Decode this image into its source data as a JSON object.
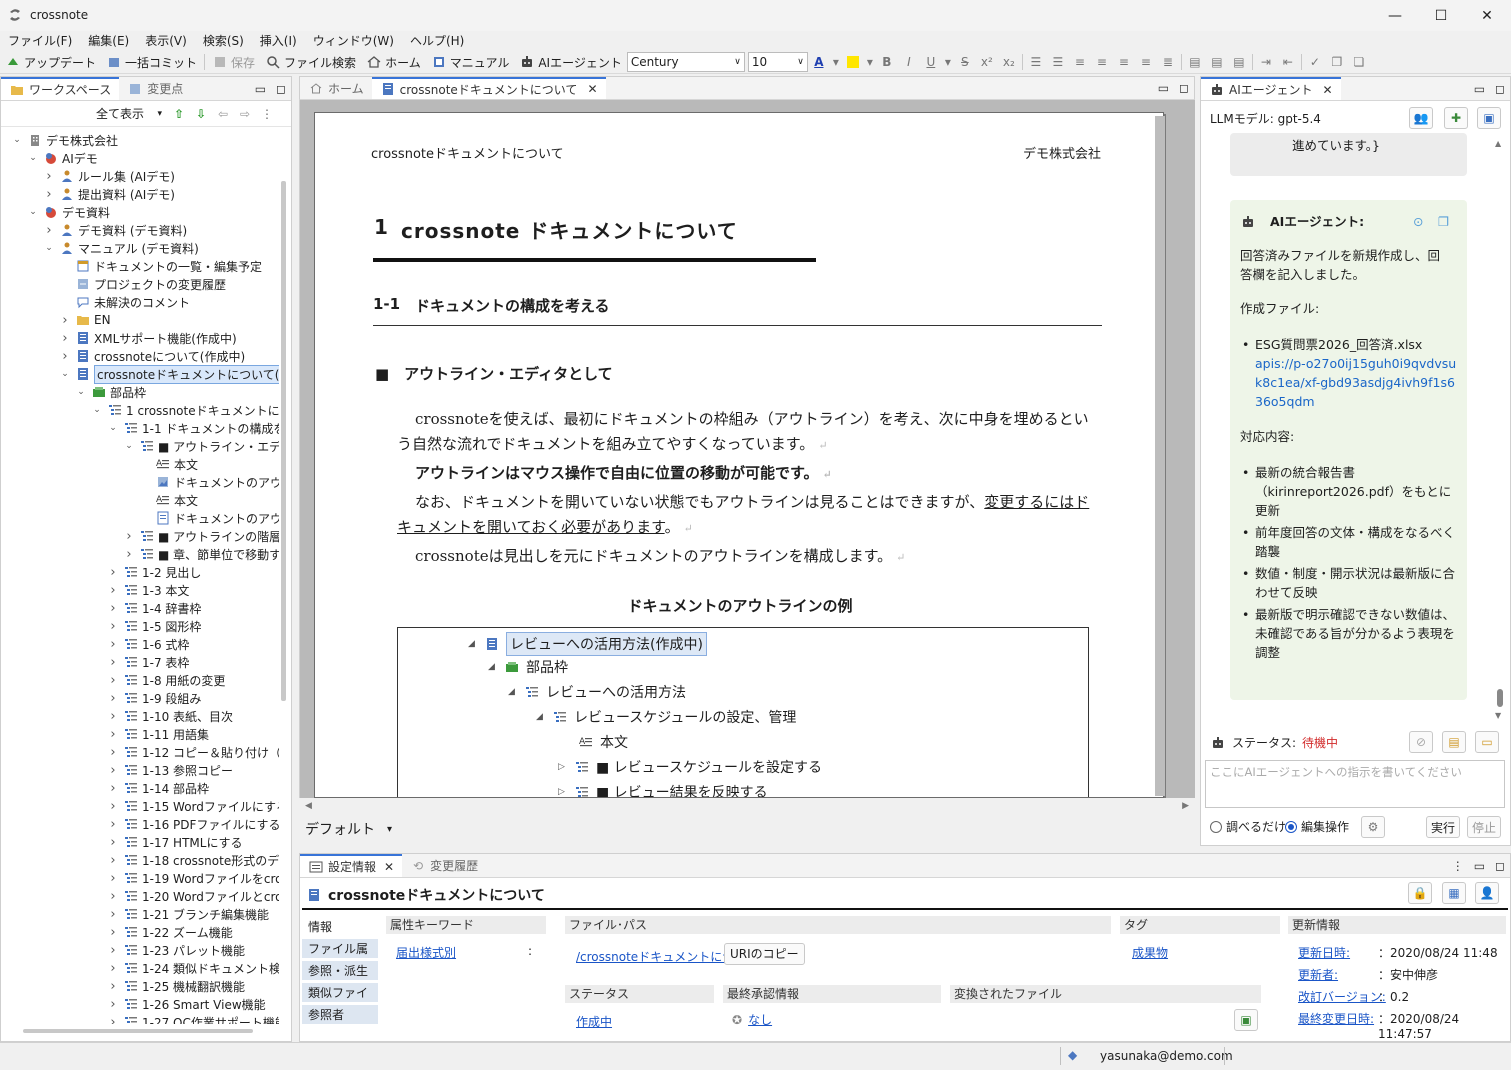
{
  "window": {
    "title": "crossnote"
  },
  "menu": [
    "ファイル(F)",
    "編集(E)",
    "表示(V)",
    "検索(S)",
    "挿入(I)",
    "ウィンドウ(W)",
    "ヘルプ(H)"
  ],
  "toolbar": {
    "update": "アップデート",
    "commit": "一括コミット",
    "save": "保存",
    "file_search": "ファイル検索",
    "home": "ホーム",
    "manual": "マニュアル",
    "ai_agent": "AIエージェント",
    "font": "Century",
    "size": "10"
  },
  "left_panel": {
    "tab_workspace": "ワークスペース",
    "tab_changes": "変更点",
    "filter": "全て表示",
    "tree": [
      {
        "d": 0,
        "t": "デモ株式会社",
        "a": "v",
        "i": "bldg"
      },
      {
        "d": 1,
        "t": "AIデモ",
        "a": "v",
        "i": "ws"
      },
      {
        "d": 2,
        "t": "ルール集 (AIデモ)",
        "a": ">",
        "i": "user"
      },
      {
        "d": 2,
        "t": "提出資料 (AIデモ)",
        "a": ">",
        "i": "user"
      },
      {
        "d": 1,
        "t": "デモ資料",
        "a": "v",
        "i": "ws"
      },
      {
        "d": 2,
        "t": "デモ資料 (デモ資料)",
        "a": ">",
        "i": "user"
      },
      {
        "d": 2,
        "t": "マニュアル (デモ資料)",
        "a": "v",
        "i": "user"
      },
      {
        "d": 3,
        "t": "ドキュメントの一覧・編集予定",
        "a": "",
        "i": "cal"
      },
      {
        "d": 3,
        "t": "プロジェクトの変更履歴",
        "a": "",
        "i": "hist"
      },
      {
        "d": 3,
        "t": "未解決のコメント",
        "a": "",
        "i": "cmt"
      },
      {
        "d": 3,
        "t": "EN",
        "a": ">",
        "i": "folder"
      },
      {
        "d": 3,
        "t": "XMLサポート機能(作成中)",
        "a": ">",
        "i": "doc"
      },
      {
        "d": 3,
        "t": "crossnoteについて(作成中)",
        "a": ">",
        "i": "doc"
      },
      {
        "d": 3,
        "t": "crossnoteドキュメントについて(作成中)",
        "a": "v",
        "i": "doc",
        "sel": true
      },
      {
        "d": 4,
        "t": "部品枠",
        "a": "v",
        "i": "green"
      },
      {
        "d": 5,
        "t": "1 crossnoteドキュメントについて",
        "a": "v",
        "i": "list"
      },
      {
        "d": 6,
        "t": "1-1 ドキュメントの構成を考え",
        "a": "v",
        "i": "list"
      },
      {
        "d": 7,
        "t": "■ アウトライン・エディタと!",
        "a": "v",
        "i": "list"
      },
      {
        "d": 8,
        "t": "本文",
        "a": "",
        "i": "text"
      },
      {
        "d": 8,
        "t": "ドキュメントのアウトライ",
        "a": "",
        "i": "pic"
      },
      {
        "d": 8,
        "t": "本文",
        "a": "",
        "i": "text"
      },
      {
        "d": 8,
        "t": "ドキュメントのアウトライ",
        "a": "",
        "i": "page"
      },
      {
        "d": 7,
        "t": "■ アウトラインの階層関係",
        "a": ">",
        "i": "list"
      },
      {
        "d": 7,
        "t": "■ 章、節単位で移動する",
        "a": ">",
        "i": "list"
      },
      {
        "d": 6,
        "t": "1-2 見出し",
        "a": ">",
        "i": "list"
      },
      {
        "d": 6,
        "t": "1-3 本文",
        "a": ">",
        "i": "list"
      },
      {
        "d": 6,
        "t": "1-4 辞書枠",
        "a": ">",
        "i": "list"
      },
      {
        "d": 6,
        "t": "1-5 図形枠",
        "a": ">",
        "i": "list"
      },
      {
        "d": 6,
        "t": "1-6 式枠",
        "a": ">",
        "i": "list"
      },
      {
        "d": 6,
        "t": "1-7 表枠",
        "a": ">",
        "i": "list"
      },
      {
        "d": 6,
        "t": "1-8 用紙の変更",
        "a": ">",
        "i": "list"
      },
      {
        "d": 6,
        "t": "1-9 段組み",
        "a": ">",
        "i": "list"
      },
      {
        "d": 6,
        "t": "1-10 表紙、目次",
        "a": ">",
        "i": "list"
      },
      {
        "d": 6,
        "t": "1-11 用語集",
        "a": ">",
        "i": "list"
      },
      {
        "d": 6,
        "t": "1-12 コピー＆貼り付け（ペー",
        "a": ">",
        "i": "list"
      },
      {
        "d": 6,
        "t": "1-13 参照コピー",
        "a": ">",
        "i": "list"
      },
      {
        "d": 6,
        "t": "1-14 部品枠",
        "a": ">",
        "i": "list"
      },
      {
        "d": 6,
        "t": "1-15 Wordファイルにする",
        "a": ">",
        "i": "list"
      },
      {
        "d": 6,
        "t": "1-16 PDFファイルにする",
        "a": ">",
        "i": "list"
      },
      {
        "d": 6,
        "t": "1-17 HTMLにする",
        "a": ">",
        "i": "list"
      },
      {
        "d": 6,
        "t": "1-18 crossnote形式のデータ",
        "a": ">",
        "i": "list"
      },
      {
        "d": 6,
        "t": "1-19 Wordファイルをcrossn",
        "a": ">",
        "i": "list"
      },
      {
        "d": 6,
        "t": "1-20 Wordファイルとcrossnc",
        "a": ">",
        "i": "list"
      },
      {
        "d": 6,
        "t": "1-21 ブランチ編集機能",
        "a": ">",
        "i": "list"
      },
      {
        "d": 6,
        "t": "1-22 ズーム機能",
        "a": ">",
        "i": "list"
      },
      {
        "d": 6,
        "t": "1-23 パレット機能",
        "a": ">",
        "i": "list"
      },
      {
        "d": 6,
        "t": "1-24 類似ドキュメント検索機",
        "a": ">",
        "i": "list"
      },
      {
        "d": 6,
        "t": "1-25 機械翻訳機能",
        "a": ">",
        "i": "list"
      },
      {
        "d": 6,
        "t": "1-26 Smart View機能",
        "a": ">",
        "i": "list"
      },
      {
        "d": 6,
        "t": "1-27 OC作業サポート機能",
        "a": ">",
        "i": "list"
      }
    ]
  },
  "editor": {
    "tab_home": "ホーム",
    "tab_doc": "crossnoteドキュメントについて",
    "header_left": "crossnoteドキュメントについて",
    "header_right": "デモ株式会社",
    "h1_num": "1",
    "h1_text": "crossnote ドキュメントについて",
    "h2_num": "1-1",
    "h2_text": "ドキュメントの構成を考える",
    "h3": "■　アウトライン・エディタとして",
    "p1": "crossnoteを使えば、最初にドキュメントの枠組み（アウトライン）を考え、次に中身を埋めるという自然な流れでドキュメントを組み立てやすくなっています。",
    "p2": "アウトラインはマウス操作で自由に位置の移動が可能です。",
    "p3a": "なお、ドキュメントを開いていない状態でもアウトラインは見ることはできますが、",
    "p3b": "変更するにはドキュメントを開いておく必要があります",
    "p3c": "。",
    "p4": "crossnoteは見出しを元にドキュメントのアウトラインを構成します。",
    "caption": "ドキュメントのアウトラインの例",
    "outline": [
      {
        "t": "レビューへの活用方法(作成中)",
        "tri": "◢",
        "i": "doc"
      },
      {
        "t": "部品枠",
        "tri": "◢",
        "i": "green"
      },
      {
        "t": "レビューへの活用方法",
        "tri": "◢",
        "i": "list"
      },
      {
        "t": "レビュースケジュールの設定、管理",
        "tri": "◢",
        "i": "list"
      },
      {
        "t": "本文",
        "tri": "",
        "i": "text"
      },
      {
        "t": "■ レビュースケジュールを設定する",
        "tri": "▷",
        "i": "list"
      },
      {
        "t": "■ レビュー結果を反映する",
        "tri": "▷",
        "i": "list"
      }
    ],
    "style_combo": "デフォルト"
  },
  "ai_panel": {
    "tab": "AIエージェント",
    "model": "LLMモデル: gpt-5.4",
    "prev_msg": "進めています。}",
    "agent_label": "AIエージェント:",
    "msg1": "回答済みファイルを新規作成し、回答欄を記入しました。",
    "created_label": "作成ファイル:",
    "file_name": "ESG質問票2026_回答済.xlsx",
    "file_link": "apis://p-o27o0ij15guh0i9qvdvsuk8c1ea/xf-gbd93asdjg4ivh9f1s636o5qdm",
    "actions_label": "対応内容:",
    "actions": [
      "最新の統合報告書（kirinreport2026.pdf）をもとに更新",
      "前年度回答の文体・構成をなるべく踏襲",
      "数値・制度・開示状況は最新版に合わせて反映",
      "最新版で明示確認できない数値は、未確認である旨が分かるよう表現を調整"
    ],
    "status_label": "ステータス:",
    "status_value": "待機中",
    "input_placeholder": "ここにAIエージェントへの指示を書いてください",
    "radio_inspect": "調べるだけ",
    "radio_edit": "編集操作",
    "run": "実行",
    "stop": "停止"
  },
  "properties": {
    "tab_settings": "設定情報",
    "tab_history": "変更履歴",
    "doc_title": "crossnoteドキュメントについて",
    "side_tabs": [
      "情報",
      "ファイル属性",
      "参照・派生",
      "類似ファイル",
      "参照者"
    ],
    "attr_key": "属性キーワード",
    "attr_name": "届出様式別",
    "attr_colon": ":",
    "filepath_label": "ファイル･パス",
    "filepath": "/crossnoteドキュメントについて",
    "uri_copy": "URIのコピー",
    "tag_label": "タグ",
    "tag_value": "成果物",
    "status_label": "ステータス",
    "status_value": "作成中",
    "approval_label": "最終承認情報",
    "approval_value": "なし",
    "converted_label": "変換されたファイル",
    "update_label": "更新情報",
    "updates": [
      {
        "k": "更新日時:",
        "v": "2020/08/24 11:48"
      },
      {
        "k": "更新者:",
        "v": "安中伸彦"
      },
      {
        "k": "改訂バージョン:",
        "v": "0.2"
      },
      {
        "k": "最終変更日時:",
        "v": "2020/08/24 11:47:57"
      }
    ]
  },
  "statusbar": {
    "user": "yasunaka@demo.com"
  },
  "colors": {
    "accent": "#3874d8",
    "status_wait": "#d22b2b",
    "link": "#1a55c7",
    "ai_bubble": "#eef5e8"
  }
}
